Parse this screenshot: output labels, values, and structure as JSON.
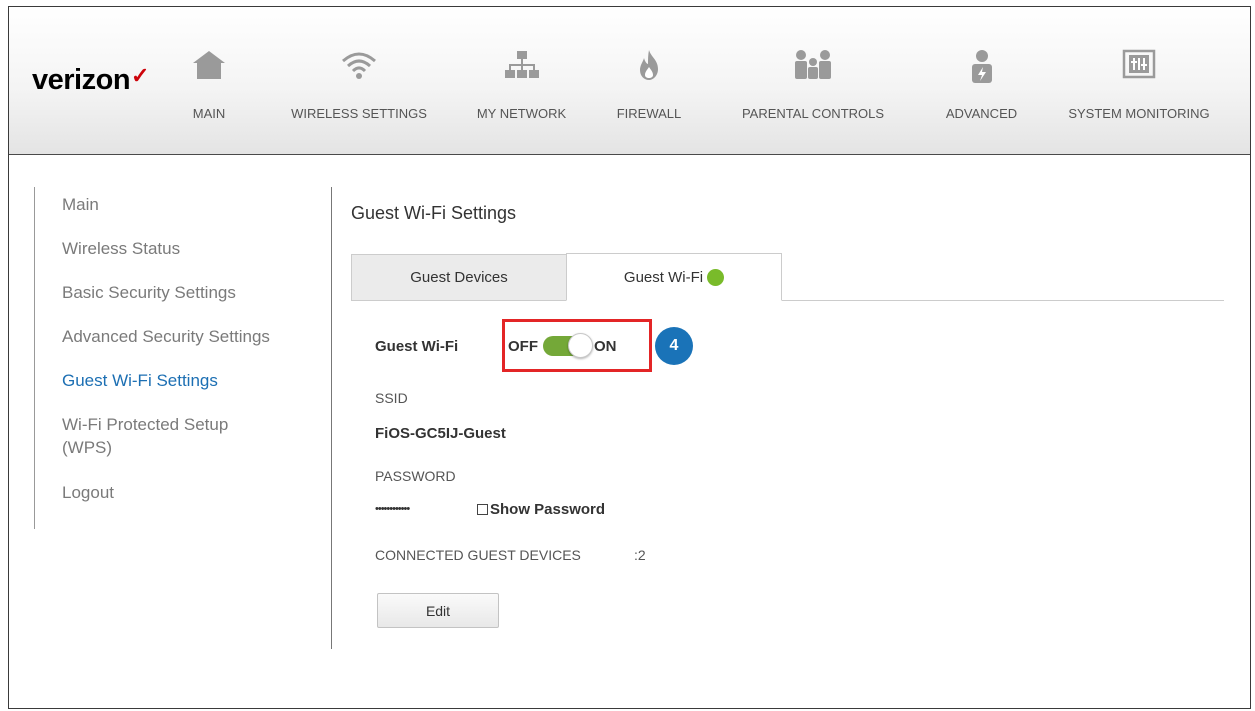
{
  "brand": {
    "logo_text": "verizon",
    "logo_mark": "✓",
    "accent": "#cd040b"
  },
  "nav": {
    "items": [
      {
        "label": "MAIN",
        "icon": "home-icon"
      },
      {
        "label": "WIRELESS SETTINGS",
        "icon": "wifi-icon"
      },
      {
        "label": "MY NETWORK",
        "icon": "network-icon"
      },
      {
        "label": "FIREWALL",
        "icon": "flame-icon"
      },
      {
        "label": "PARENTAL CONTROLS",
        "icon": "family-icon"
      },
      {
        "label": "ADVANCED",
        "icon": "advanced-user-icon"
      },
      {
        "label": "SYSTEM MONITORING",
        "icon": "monitor-icon"
      }
    ]
  },
  "sidebar": {
    "items": [
      {
        "label": "Main"
      },
      {
        "label": "Wireless Status"
      },
      {
        "label": "Basic Security Settings"
      },
      {
        "label": "Advanced Security Settings"
      },
      {
        "label": "Guest Wi-Fi Settings",
        "active": true
      },
      {
        "label": "Wi-Fi Protected Setup\n(WPS)"
      },
      {
        "label": "Logout"
      }
    ],
    "active_color": "#1c6fb3"
  },
  "main": {
    "title": "Guest Wi-Fi Settings",
    "tabs": [
      {
        "label": "Guest Devices",
        "active": false
      },
      {
        "label": "Guest Wi-Fi",
        "active": true,
        "status_color": "#79bb2a"
      }
    ],
    "guest_wifi": {
      "label": "Guest Wi-Fi",
      "toggle_off_label": "OFF",
      "toggle_on_label": "ON",
      "toggle_state": "on",
      "step_badge": "4"
    },
    "ssid": {
      "label": "SSID",
      "value": "FiOS-GC5IJ-Guest"
    },
    "password": {
      "label": "PASSWORD",
      "masked_value": "••••••••••••",
      "show_password_label": "Show Password",
      "show_password_checked": false
    },
    "connected": {
      "label": "CONNECTED GUEST DEVICES",
      "value": ":2"
    },
    "edit_button": "Edit"
  }
}
